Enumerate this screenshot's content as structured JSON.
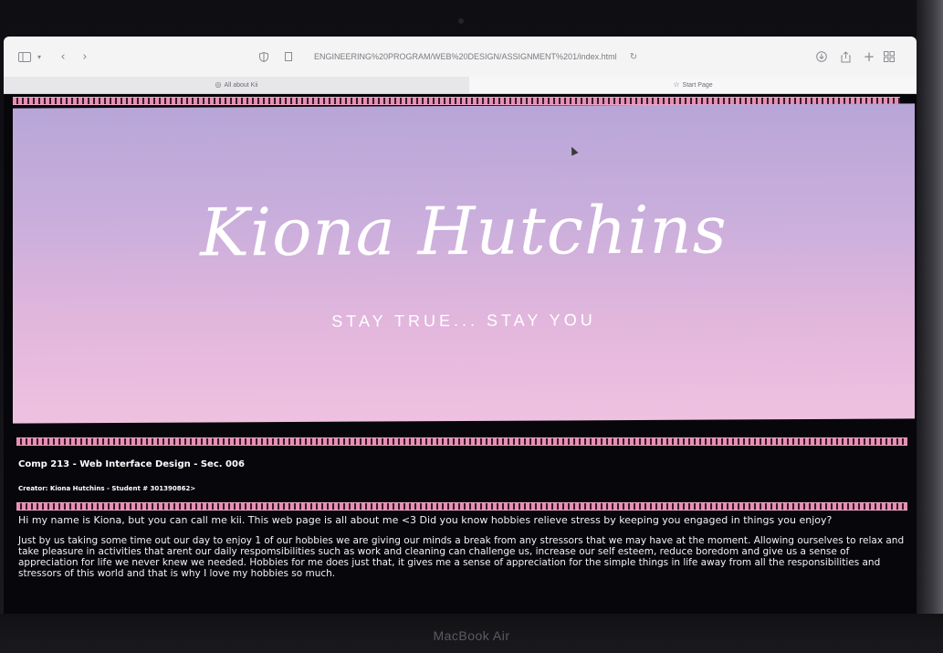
{
  "browser": {
    "url": "ENGINEERING%20PROGRAM/WEB%20DESIGN/ASSIGNMENT%201/index.html",
    "tabs": [
      {
        "label": "All about Kii",
        "active": false
      },
      {
        "label": "Start Page",
        "active": true
      }
    ],
    "icons": [
      "sidebar-icon",
      "chevron-down-icon",
      "back-icon",
      "forward-icon",
      "shield-icon",
      "page-icon",
      "reload-icon",
      "download-icon",
      "share-icon",
      "new-tab-icon",
      "tab-overview-icon"
    ]
  },
  "page": {
    "banner": {
      "title": "Kiona Hutchins",
      "tagline": "STAY TRUE... STAY YOU"
    },
    "course_line": "Comp 213 - Web Interface Design - Sec. 006",
    "creator_line": "Creator: Kiona Hutchins - Student # 301390862>",
    "intro": "Hi my name is Kiona, but you can call me kii. This web page is all about me <3 Did you know hobbies relieve stress by keeping you engaged in things you enjoy?",
    "paragraph": "Just by us taking some time out our day to enjoy 1 of our hobbies we are giving our minds a break from any stressors that we may have at the moment. Allowing ourselves to relax and take pleasure in activities that arent our daily respomsibilities such as work and cleaning can challenge us, increase our self esteem, reduce boredom and give us a sense of appreciation for life we never knew we needed. Hobbies for me does just that, it gives me a sense of appreciation for the simple things in life away from all the responsibilities and stressors of this world and that is why I love my hobbies so much.",
    "colors": {
      "accent": "#e58fb4",
      "banner_top": "#b8a6d8",
      "banner_bottom": "#efc1e0"
    }
  },
  "device": {
    "label": "MacBook Air"
  }
}
